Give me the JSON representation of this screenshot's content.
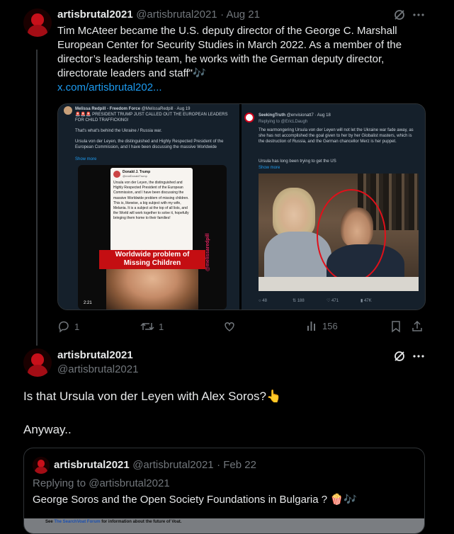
{
  "tweet1": {
    "name": "artisbrutal2021",
    "handle": "@artisbrutal2021",
    "date": "· Aug 21",
    "text": "Tim McAteer became the U.S. deputy director of the George C. Marshall European Center for Security Studies in March 2022. As a member of the director’s leadership team, he works with the German deputy director, directorate leaders and staff\"",
    "text_emoji": "🎶",
    "link": "x.com/artisbrutal202...",
    "media_left": {
      "name": "Melissa Redpill - Freedom Force",
      "handle": "@MelissaRedpill · Aug 19",
      "flags": "🚨🚨🚨",
      "line1": "PRESIDENT TRUMP JUST CALLED OUT THE EUROPEAN LEADERS FOR CHILD TRAFFICKING!",
      "line2": "That's what's behind the Ukraine / Russia war.",
      "line3": "Ursula von der Leyen, the distinguished and Highly Respected President of the European Commission, and I have been discussing the massive Worldwide",
      "show_more": "Show more",
      "inner_name": "Donald J. Trump",
      "inner_handle": "@realDonaldTrump",
      "inner_text": "Ursula von der Leyen, the distinguished and Highly Respected President of the European Commission, and I have been discussing the massive Worldwide problem of missing children. This is, likewise, a big subject with my wife, Melania. It is a subject at the top of all lists, and the World will work together to solve it, hopefully bringing them home to their families!",
      "caption1": "Worldwide problem of",
      "caption2": "Missing Children",
      "watermark": "@melissaredpill",
      "duration": "2:21"
    },
    "media_right": {
      "name": "SeekingTruth",
      "handle": "@envisionatt7 · Aug 18",
      "replying": "Replying to @EricLDaugh",
      "text": "The warmongering Ursula von der Leyen will not let the Ukraine war fade away, as she has not accomplished the goal given to her by her Globalist masters, which is the destruction of Russia, and the German chancellor Merz is her puppet.",
      "text2": "Ursula has long been trying to get the US",
      "show_more": "Show more",
      "stats": [
        "48",
        "188",
        "471",
        "47K"
      ]
    },
    "actions": {
      "reply": "1",
      "retweet": "1",
      "like": "",
      "views": "156"
    }
  },
  "tweet2": {
    "name": "artisbrutal2021",
    "handle": "@artisbrutal2021",
    "text1": "Is that Ursula von der Leyen with Alex Soros?",
    "text1_emoji": "👆",
    "text2": "Anyway..",
    "quote": {
      "name": "artisbrutal2021",
      "handle": "@artisbrutal2021",
      "date": "· Feb 22",
      "replying": "Replying to @artisbrutal2021",
      "text": "George Soros and the Open Society Foundations in Bulgaria ?",
      "emojis": "🍿🎶",
      "banner_pre": "See ",
      "banner_link": "The SearchVoat Forum",
      "banner_post": " for information about the future of Voat."
    }
  },
  "colors": {
    "accent": "#1d9bf0",
    "muted": "#71767b",
    "bg": "#000000",
    "border": "#2f3336"
  }
}
